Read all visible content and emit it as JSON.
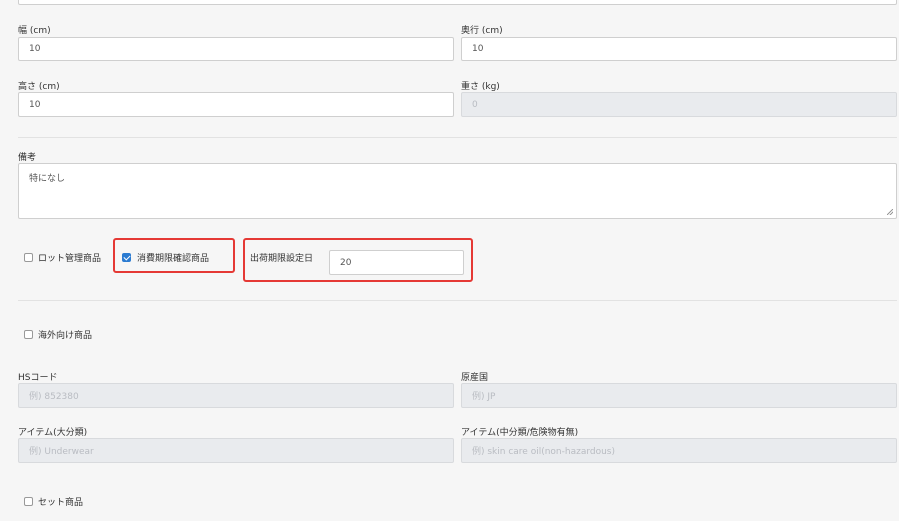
{
  "fields": {
    "width": {
      "label": "幅 (cm)",
      "value": "10"
    },
    "depth": {
      "label": "奥行 (cm)",
      "value": "10"
    },
    "height": {
      "label": "高さ (cm)",
      "value": "10"
    },
    "weight": {
      "label": "重さ (kg)",
      "value": "0"
    },
    "notes": {
      "label": "備考",
      "value": "特になし"
    },
    "hs_code": {
      "label": "HSコード",
      "placeholder": "例) 852380"
    },
    "origin": {
      "label": "原産国",
      "placeholder": "例) JP"
    },
    "item_major": {
      "label": "アイテム(大分類)",
      "placeholder": "例) Underwear"
    },
    "item_middle": {
      "label": "アイテム(中分類/危険物有無)",
      "placeholder": "例) skin care oil(non-hazardous)"
    }
  },
  "checkboxes": {
    "lot_managed": {
      "label": "ロット管理商品",
      "checked": false
    },
    "expiry_check": {
      "label": "消費期限確認商品",
      "checked": true
    },
    "overseas": {
      "label": "海外向け商品",
      "checked": false
    },
    "set_item": {
      "label": "セット商品",
      "checked": false
    }
  },
  "shipping_limit": {
    "label": "出荷期限設定日",
    "value": "20"
  }
}
